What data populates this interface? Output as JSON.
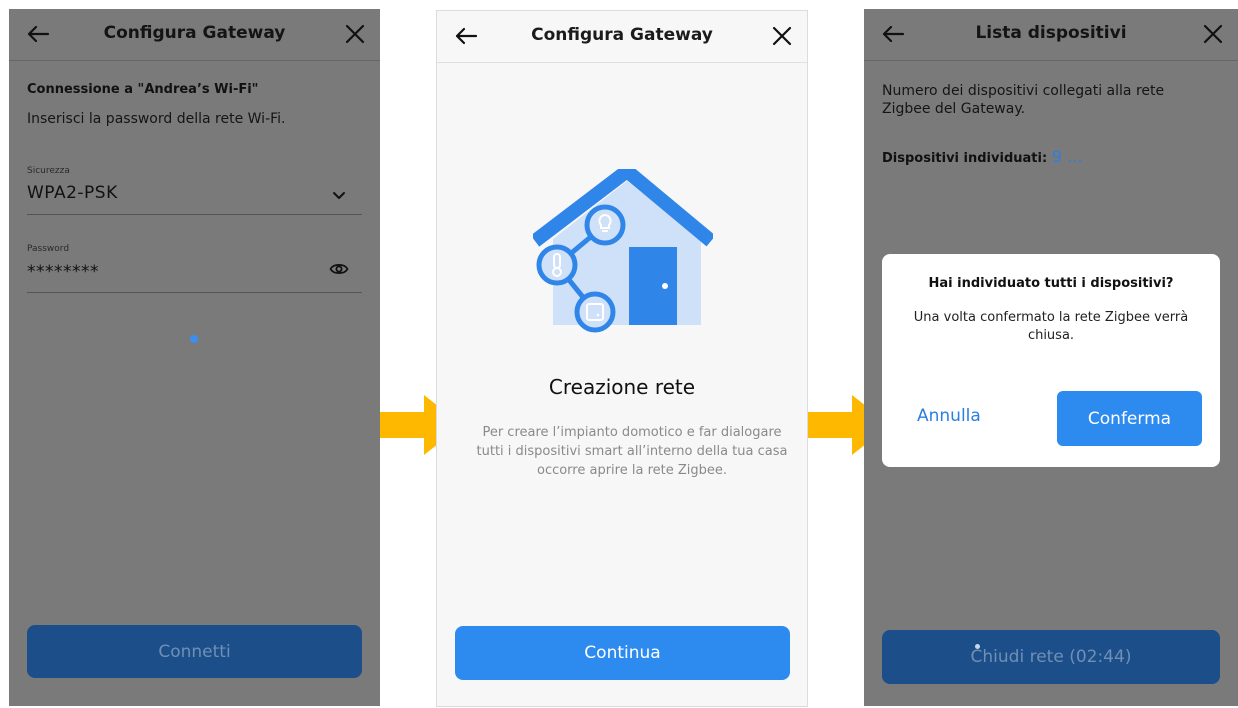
{
  "screen1": {
    "title": "Configura Gateway",
    "heading": "Connessione a \"Andrea’s Wi-Fi\"",
    "subtitle": "Inserisci la password della rete Wi-Fi.",
    "security_label": "Sicurezza",
    "security_value": "WPA2-PSK",
    "password_label": "Password",
    "password_value": "********",
    "connect_label": "Connetti"
  },
  "screen2": {
    "title": "Configura Gateway",
    "heading": "Creazione rete",
    "description": "Per creare l’impianto domotico e far dialogare tutti i dispositivi smart all’interno della tua casa occorre aprire la rete Zigbee.",
    "continue_label": "Continua"
  },
  "screen3": {
    "title": "Lista dispositivi",
    "intro": "Numero dei dispositivi collegati alla rete Zigbee del Gateway.",
    "found_label": "Dispositivi individuati:",
    "found_count": "9 …",
    "close_network_label": "Chiudi rete (02:44)",
    "dialog": {
      "title": "Hai individuato tutti i dispositivi?",
      "body": "Una volta confermato la rete Zigbee verrà chiusa.",
      "cancel_label": "Annulla",
      "confirm_label": "Conferma"
    }
  },
  "colors": {
    "primary": "#2d8bf0",
    "flow_arrow": "#ffb800",
    "house_roof": "#2f86e8",
    "house_wall": "#cfe1f8"
  },
  "icons": {
    "back": "arrow-left-icon",
    "close": "close-icon",
    "dropdown": "chevron-down-icon",
    "visibility": "eye-icon",
    "illustration": "smart-home-icon"
  }
}
